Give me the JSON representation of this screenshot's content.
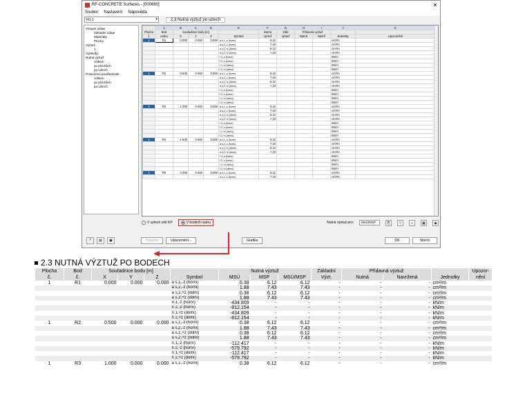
{
  "window": {
    "title": "RF-CONCRETE Surfaces - [000680]",
    "menu": [
      "Soubor",
      "Nastavení",
      "Nápověda"
    ],
    "case_combo": "FÚ 1",
    "panel_title": "2.3 Nutná výztuž po uzlech"
  },
  "nav": [
    {
      "level": 0,
      "label": "Vstupní údaje"
    },
    {
      "level": 1,
      "label": "Základní údaje"
    },
    {
      "level": 1,
      "label": "Materiály"
    },
    {
      "level": 1,
      "label": "Plochy"
    },
    {
      "level": 0,
      "label": "Výztuž"
    },
    {
      "level": 1,
      "label": "1"
    },
    {
      "level": 0,
      "label": "Výsledky"
    },
    {
      "level": 0,
      "label": "Nutná výztuž"
    },
    {
      "level": 1,
      "label": "celkem"
    },
    {
      "level": 1,
      "label": "po plochách"
    },
    {
      "level": 1,
      "label": "po uzlech"
    },
    {
      "level": 0,
      "label": "Posouzení použitelnosti"
    },
    {
      "level": 1,
      "label": "celkem"
    },
    {
      "level": 1,
      "label": "po plochách"
    },
    {
      "level": 1,
      "label": "po uzlech"
    }
  ],
  "grid": {
    "col_letters": [
      "A",
      "B",
      "C",
      "D",
      "E",
      "F",
      "G",
      "H",
      "I",
      "J",
      "K"
    ],
    "head1": [
      "Plocha",
      "Bod",
      "Souřadnice bodu [m]",
      "",
      "Nutná",
      "Zákl",
      "Přídavná výztuž",
      "",
      ""
    ],
    "head2": [
      "č.",
      "rastru",
      "X",
      "Y",
      "Z",
      "Symbol",
      "výztuž",
      "výztuž",
      "Nutná",
      "Návrh",
      "Jednotky",
      "Upozornění"
    ],
    "groups": [
      {
        "plocha": "1",
        "bod": "R1",
        "x": "0.000",
        "y": "0.000",
        "z": "0.000"
      },
      {
        "plocha": "1",
        "bod": "R2",
        "x": "0.500",
        "y": "0.000",
        "z": "0.000"
      },
      {
        "plocha": "1",
        "bod": "R3",
        "x": "1.000",
        "y": "0.000",
        "z": "0.000"
      },
      {
        "plocha": "1",
        "bod": "R4",
        "x": "1.500",
        "y": "0.000",
        "z": "0.000"
      },
      {
        "plocha": "1",
        "bod": "R5",
        "x": "2.000",
        "y": "0.000",
        "z": "0.000"
      }
    ],
    "symbols": [
      "a s,1,-z (horní)",
      "a s,2,-z (horní)",
      "a s,1,+z (dolní)",
      "a s,2,+z (dolní)",
      "f 1,-z (horní)",
      "f 2,-z (horní)",
      "f 1,+z (dolní)",
      "f 2,+z (dolní)"
    ],
    "values": [
      "6.12",
      "7.43",
      "6.12",
      "7.43",
      "",
      "",
      "",
      ""
    ],
    "units": [
      "cm²/m",
      "cm²/m",
      "cm²/m",
      "cm²/m",
      "kN/m",
      "kN/m",
      "kN/m",
      "kN/m"
    ]
  },
  "options": {
    "radio1": "V uzlech sítě KP",
    "radio2": "V bodech rastru",
    "reinf_label": "Nutná výztuž pro:",
    "reinf_value": "MSÚ/MSP"
  },
  "buttons": {
    "calc": "Výpočet",
    "warnings": "Upozornění...",
    "graphics": "Grafika",
    "ok": "OK",
    "cancel": "Storno"
  },
  "printout": {
    "title": "2.3 NUTNÁ VÝZTUŽ PO BODECH",
    "head1": [
      "Plocha",
      "Bod",
      "Souřadnice bodu [m]",
      "Nutná výztuž",
      "Základní",
      "Přídavná výztuž",
      "Upozor-"
    ],
    "head2": [
      "č.",
      "č.",
      "X",
      "Y",
      "Z",
      "Symbol",
      "MSÚ",
      "MSP",
      "MSÚ/MSP",
      "Výzt.",
      "Nutná",
      "Navržená",
      "Jednotky",
      "nění"
    ],
    "rows": [
      {
        "plocha": "1",
        "bod": "R1",
        "x": "0.000",
        "y": "0.000",
        "z": "0.000",
        "sym": "a s,1,-z (horní)",
        "msu": "0.38",
        "msp": "6.12",
        "both": "6.12",
        "unit": "cm²/m"
      },
      {
        "plocha": "",
        "bod": "",
        "x": "",
        "y": "",
        "z": "",
        "sym": "a s,2,-z (horní)",
        "msu": "1.88",
        "msp": "7.43",
        "both": "7.43",
        "unit": "cm²/m"
      },
      {
        "plocha": "",
        "bod": "",
        "x": "",
        "y": "",
        "z": "",
        "sym": "a s,1,+z (dolní)",
        "msu": "0.38",
        "msp": "6.12",
        "both": "6.12",
        "unit": "cm²/m"
      },
      {
        "plocha": "",
        "bod": "",
        "x": "",
        "y": "",
        "z": "",
        "sym": "a s,2,+z (dolní)",
        "msu": "1.88",
        "msp": "7.43",
        "both": "7.43",
        "unit": "cm²/m"
      },
      {
        "plocha": "",
        "bod": "",
        "x": "",
        "y": "",
        "z": "",
        "sym": "n 1,-z (horní)",
        "msu": "-434.809",
        "msp": "-",
        "both": "-",
        "unit": "kN/m"
      },
      {
        "plocha": "",
        "bod": "",
        "x": "",
        "y": "",
        "z": "",
        "sym": "n 2,-z (horní)",
        "msu": "-812.154",
        "msp": "-",
        "both": "-",
        "unit": "kN/m"
      },
      {
        "plocha": "",
        "bod": "",
        "x": "",
        "y": "",
        "z": "",
        "sym": "n 1,+z (dolní)",
        "msu": "-434.809",
        "msp": "-",
        "both": "-",
        "unit": "kN/m"
      },
      {
        "plocha": "",
        "bod": "",
        "x": "",
        "y": "",
        "z": "",
        "sym": "n 2,+z (dolní)",
        "msu": "-812.154",
        "msp": "-",
        "both": "-",
        "unit": "kN/m"
      },
      {
        "plocha": "1",
        "bod": "R2",
        "x": "0.500",
        "y": "0.000",
        "z": "0.000",
        "sym": "a s,1,-z (horní)",
        "msu": "0.38",
        "msp": "6.12",
        "both": "6.12",
        "unit": "cm²/m"
      },
      {
        "plocha": "",
        "bod": "",
        "x": "",
        "y": "",
        "z": "",
        "sym": "a s,2,-z (horní)",
        "msu": "1.88",
        "msp": "7.43",
        "both": "7.43",
        "unit": "cm²/m"
      },
      {
        "plocha": "",
        "bod": "",
        "x": "",
        "y": "",
        "z": "",
        "sym": "a s,1,+z (dolní)",
        "msu": "0.38",
        "msp": "6.12",
        "both": "6.12",
        "unit": "cm²/m"
      },
      {
        "plocha": "",
        "bod": "",
        "x": "",
        "y": "",
        "z": "",
        "sym": "a s,2,+z (dolní)",
        "msu": "1.88",
        "msp": "7.43",
        "both": "7.43",
        "unit": "cm²/m"
      },
      {
        "plocha": "",
        "bod": "",
        "x": "",
        "y": "",
        "z": "",
        "sym": "n 1,-z (horní)",
        "msu": "-112.417",
        "msp": "-",
        "both": "-",
        "unit": "kN/m"
      },
      {
        "plocha": "",
        "bod": "",
        "x": "",
        "y": "",
        "z": "",
        "sym": "n 2,-z (horní)",
        "msu": "-579.792",
        "msp": "-",
        "both": "-",
        "unit": "kN/m"
      },
      {
        "plocha": "",
        "bod": "",
        "x": "",
        "y": "",
        "z": "",
        "sym": "n 1,+z (dolní)",
        "msu": "-112.417",
        "msp": "-",
        "both": "-",
        "unit": "kN/m"
      },
      {
        "plocha": "",
        "bod": "",
        "x": "",
        "y": "",
        "z": "",
        "sym": "n 2,+z (dolní)",
        "msu": "-579.792",
        "msp": "-",
        "both": "-",
        "unit": "kN/m"
      },
      {
        "plocha": "1",
        "bod": "R3",
        "x": "1.000",
        "y": "0.000",
        "z": "0.000",
        "sym": "a s,1,-z (horní)",
        "msu": "0.38",
        "msp": "6.12",
        "both": "6.12",
        "unit": "cm²/m"
      }
    ]
  }
}
